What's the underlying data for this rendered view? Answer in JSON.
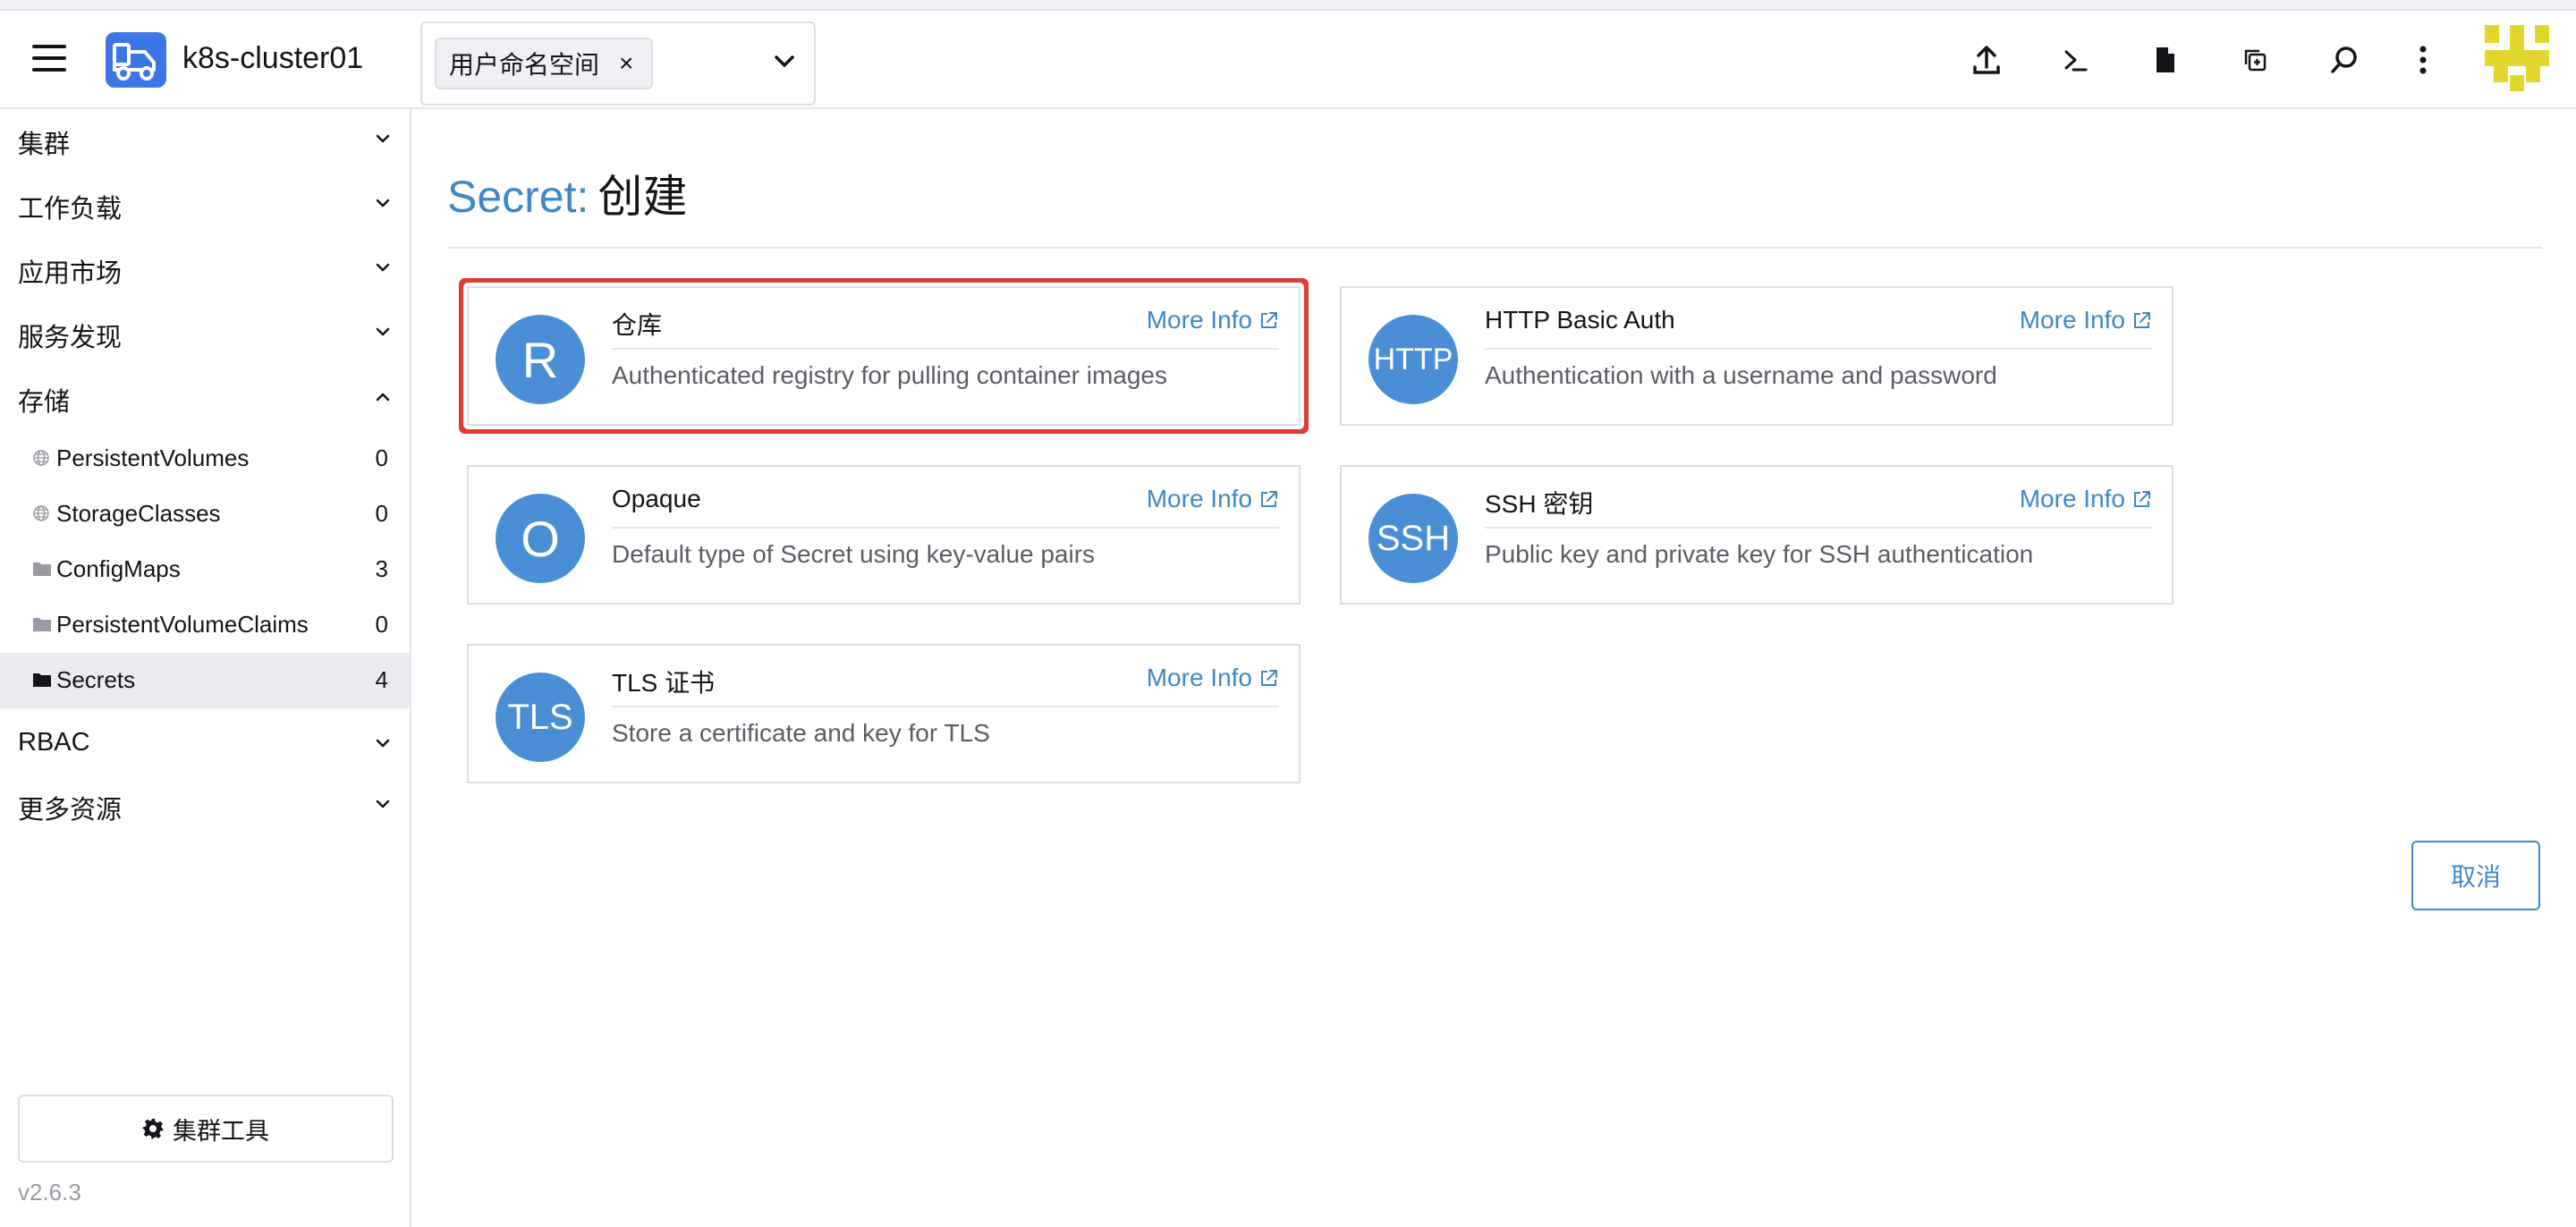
{
  "header": {
    "cluster_name": "k8s-cluster01",
    "namespace_chip": "用户命名空间",
    "namespace_chip_remove": "×"
  },
  "sidebar": {
    "groups": [
      {
        "label": "集群",
        "expanded": false
      },
      {
        "label": "工作负载",
        "expanded": false
      },
      {
        "label": "应用市场",
        "expanded": false
      },
      {
        "label": "服务发现",
        "expanded": false
      },
      {
        "label": "存储",
        "expanded": true
      },
      {
        "label": "RBAC",
        "expanded": false
      },
      {
        "label": "更多资源",
        "expanded": false
      }
    ],
    "storage_items": [
      {
        "label": "PersistentVolumes",
        "count": "0",
        "icon": "globe-icon"
      },
      {
        "label": "StorageClasses",
        "count": "0",
        "icon": "globe-icon"
      },
      {
        "label": "ConfigMaps",
        "count": "3",
        "icon": "folder-icon"
      },
      {
        "label": "PersistentVolumeClaims",
        "count": "0",
        "icon": "folder-icon"
      },
      {
        "label": "Secrets",
        "count": "4",
        "icon": "folder-icon",
        "active": true
      }
    ],
    "cluster_tools_label": "集群工具",
    "version": "v2.6.3"
  },
  "main": {
    "title_kind": "Secret:",
    "title_action": "创建",
    "more_info_label": "More Info",
    "cards": [
      {
        "initial": "R",
        "name": "仓库",
        "description": "Authenticated registry for pulling container images",
        "selected": true
      },
      {
        "initial": "HTTP",
        "name": "HTTP Basic Auth",
        "description": "Authentication with a username and password"
      },
      {
        "initial": "O",
        "name": "Opaque",
        "description": "Default type of Secret using key-value pairs"
      },
      {
        "initial": "SSH",
        "name": "SSH 密钥",
        "description": "Public key and private key for SSH authentication"
      },
      {
        "initial": "TLS",
        "name": "TLS 证书",
        "description": "Store a certificate and key for TLS"
      }
    ],
    "cancel_label": "取消"
  },
  "colors": {
    "accent": "#3d88c8",
    "circle": "#4a8fd6",
    "logo": "#3d75e4",
    "selection": "#dd3b34",
    "avatar": "#e3d72f"
  }
}
